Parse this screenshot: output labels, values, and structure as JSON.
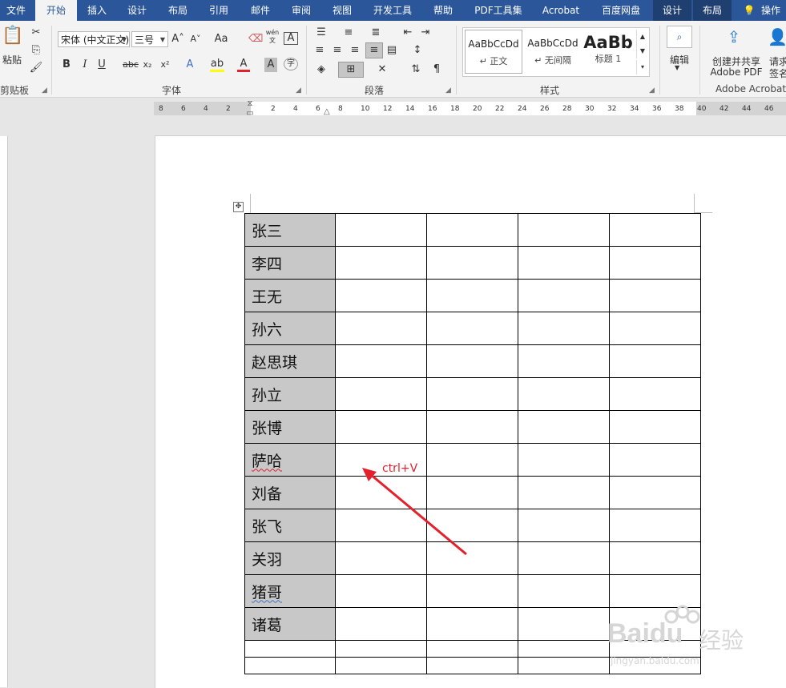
{
  "tabs": {
    "file": "文件",
    "home": "开始",
    "insert": "插入",
    "design": "设计",
    "layout": "布局",
    "references": "引用",
    "mailings": "邮件",
    "review": "审阅",
    "view": "视图",
    "developer": "开发工具",
    "help": "帮助",
    "pdf_tools": "PDF工具集",
    "acrobat": "Acrobat",
    "baidu_disk": "百度网盘",
    "table_design": "设计",
    "table_layout": "布局",
    "tell_me": "操作"
  },
  "clipboard": {
    "paste": "粘贴",
    "label": "剪贴板"
  },
  "font": {
    "name": "宋体 (中文正文)",
    "size": "三号",
    "label": "字体",
    "aa": "Aa",
    "wen": "wén"
  },
  "paragraph": {
    "label": "段落"
  },
  "styles": {
    "label": "样式",
    "items": [
      {
        "preview": "AaBbCcDd",
        "name": "↵ 正文"
      },
      {
        "preview": "AaBbCcDd",
        "name": "↵ 无间隔"
      },
      {
        "preview": "AaBb",
        "name": "标题 1"
      }
    ]
  },
  "editing": {
    "label": "编辑"
  },
  "acrobat_group": {
    "create_share": "创建并共享",
    "adobe_pdf": "Adobe PDF",
    "request": "请求",
    "sign": "签名",
    "label": "Adobe Acrobat"
  },
  "ruler": {
    "left_numbers": [
      "8",
      "6",
      "4",
      "2"
    ],
    "right_numbers": [
      "2",
      "4",
      "6",
      "8",
      "10",
      "12",
      "14",
      "16",
      "18",
      "20",
      "22",
      "24",
      "26",
      "28",
      "30",
      "32",
      "34",
      "36",
      "38",
      "40",
      "42",
      "44",
      "46"
    ]
  },
  "table": {
    "names": [
      "张三",
      "李四",
      "王无",
      "孙六",
      "赵思琪",
      "孙立",
      "张博",
      "萨哈",
      "刘备",
      "张飞",
      "关羽",
      "猪哥",
      "诸葛"
    ],
    "empty_columns": 4
  },
  "annotation": {
    "text": "ctrl+V",
    "color": "#e3202c"
  },
  "watermark": {
    "brand": "Baidu",
    "sub": "经验",
    "url": "jingyan.baidu.com"
  },
  "colors": {
    "accent": "#2b579a",
    "name_cell_bg": "#c8c8c8",
    "annotation": "#e3202c"
  }
}
